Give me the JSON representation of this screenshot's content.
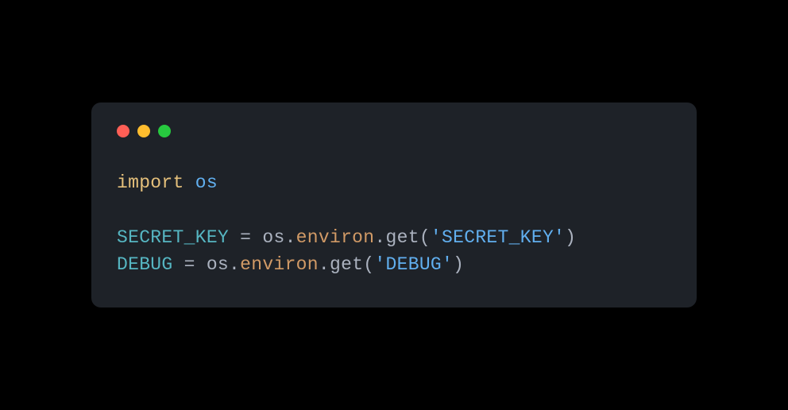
{
  "window": {
    "controls": [
      "close",
      "minimize",
      "maximize"
    ]
  },
  "code": {
    "line1": {
      "keyword": "import",
      "module": "os"
    },
    "line3": {
      "variable": "SECRET_KEY",
      "operator": " = ",
      "object": "os",
      "dot1": ".",
      "property": "environ",
      "dot2": ".",
      "method": "get",
      "paren_open": "(",
      "string": "'SECRET_KEY'",
      "paren_close": ")"
    },
    "line4": {
      "variable": "DEBUG",
      "operator": " = ",
      "object": "os",
      "dot1": ".",
      "property": "environ",
      "dot2": ".",
      "method": "get",
      "paren_open": "(",
      "string": "'DEBUG'",
      "paren_close": ")"
    }
  }
}
